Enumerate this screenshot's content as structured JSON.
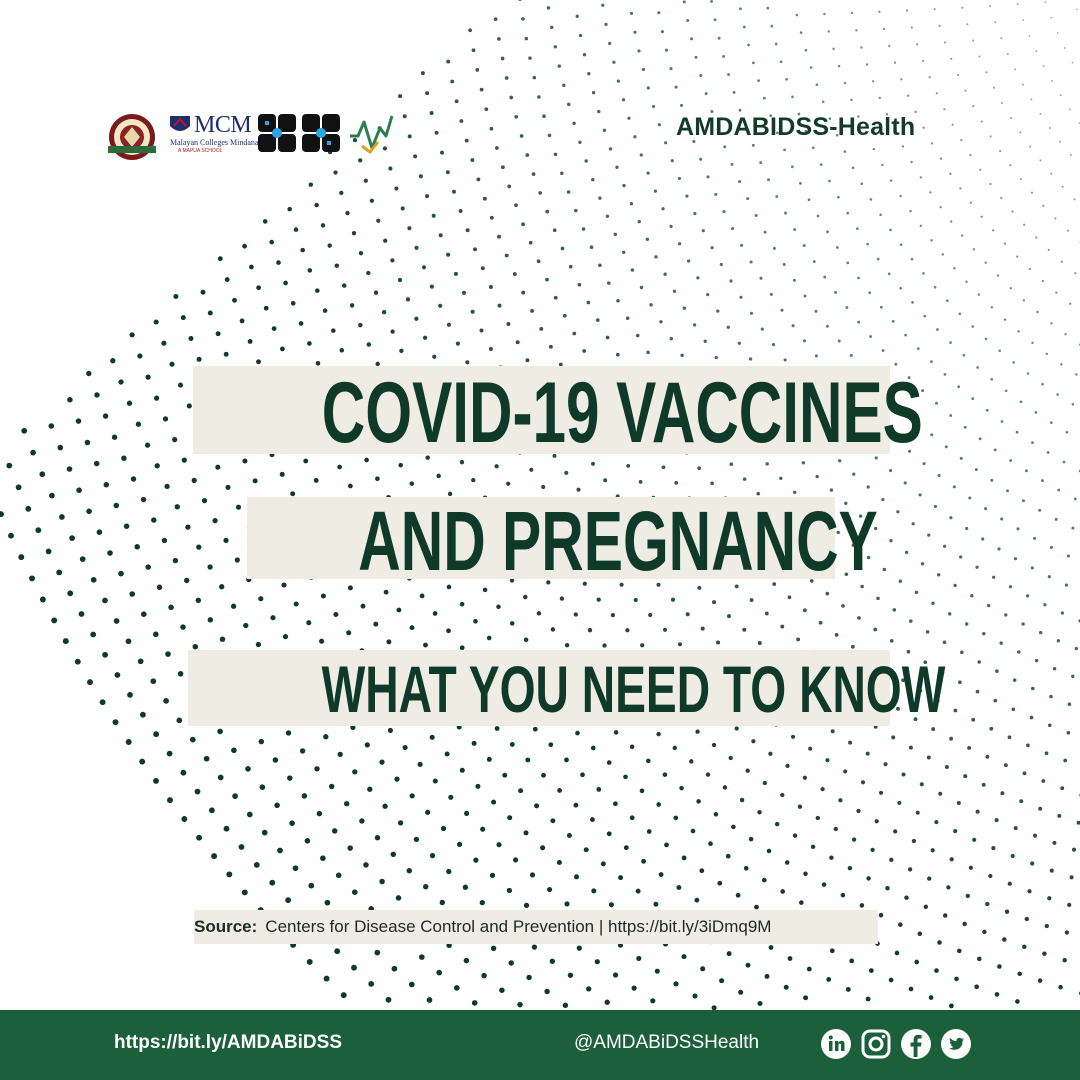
{
  "brand": "AMDABIDSS-Health",
  "logos": {
    "mcm": "MCM",
    "mcm_sub": "Malayan Colleges Mindanao",
    "mcm_sub2": "A MAPUA SCHOOL"
  },
  "title": {
    "line1": "COVID-19 VACCINES",
    "line2": "AND PREGNANCY",
    "line3": "WHAT YOU NEED TO KNOW"
  },
  "source": {
    "label": "Source:",
    "text": "Centers for Disease Control and Prevention | https://bit.ly/3iDmq9M"
  },
  "footer": {
    "url": "https://bit.ly/AMDABiDSS",
    "handle": "@AMDABiDSSHealth",
    "social_icons": [
      "linkedin-icon",
      "instagram-icon",
      "facebook-icon",
      "twitter-icon"
    ]
  },
  "colors": {
    "dark_green": "#0f3a29",
    "footer_green": "#1b5f3b",
    "highlight": "#efece4"
  }
}
